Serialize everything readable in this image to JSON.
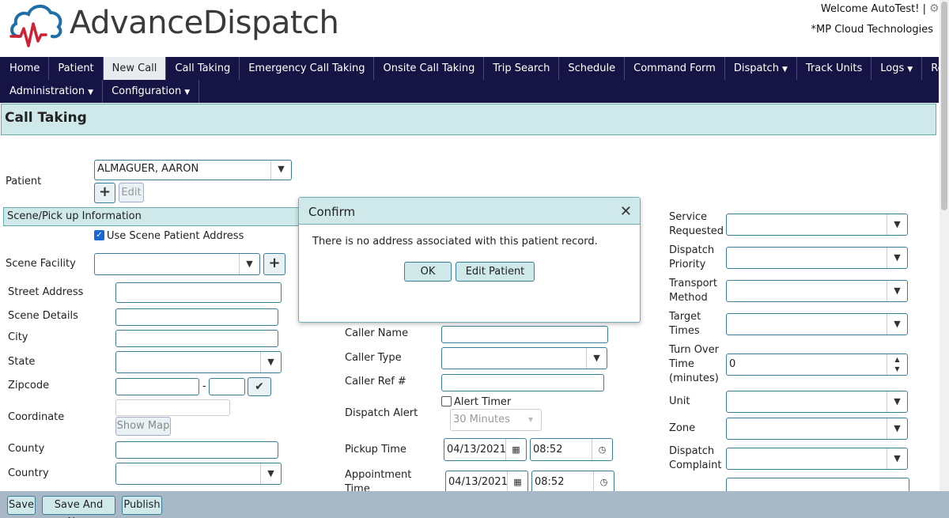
{
  "header": {
    "app_name": "AdvanceDispatch",
    "welcome": "Welcome AutoTest! |",
    "company": "*MP Cloud Technologies"
  },
  "nav": {
    "row1": [
      "Home",
      "Patient",
      "New Call",
      "Call Taking",
      "Emergency Call Taking",
      "Onsite Call Taking",
      "Trip Search",
      "Schedule",
      "Command Form",
      "Dispatch",
      "Track Units",
      "Logs",
      "Reports"
    ],
    "row2": [
      "Administration",
      "Configuration"
    ],
    "active": "New Call"
  },
  "page_title": "Call Taking",
  "form": {
    "patient_label": "Patient",
    "patient_value": "ALMAGUER, AARON",
    "edit_label": "Edit",
    "add_label": "+",
    "section_scene": "Scene/Pick up Information",
    "use_scene_addr": "Use Scene Patient Address",
    "scene_facility": "Scene Facility",
    "street_address": "Street Address",
    "scene_details": "Scene Details",
    "city": "City",
    "state": "State",
    "zipcode": "Zipcode",
    "zip_dash": "-",
    "coordinate": "Coordinate",
    "show_map": "Show Map",
    "county": "County",
    "country": "Country",
    "caller_name": "Caller Name",
    "caller_type": "Caller Type",
    "caller_ref": "Caller Ref #",
    "alert_timer": "Alert Timer",
    "dispatch_alert": "Dispatch Alert",
    "dispatch_alert_value": "30 Minutes",
    "pickup_time": "Pickup Time",
    "pickup_date": "04/13/2021",
    "pickup_clock": "08:52",
    "appointment_time_1": "Appointment",
    "appointment_time_2": "Time",
    "appt_date": "04/13/2021",
    "appt_clock": "08:52",
    "service_requested_1": "Service",
    "service_requested_2": "Requested",
    "dispatch_priority_1": "Dispatch",
    "dispatch_priority_2": "Priority",
    "transport_method_1": "Transport",
    "transport_method_2": "Method",
    "target_times_1": "Target",
    "target_times_2": "Times",
    "turn_over_1": "Turn Over",
    "turn_over_2": "Time",
    "turn_over_3": "(minutes)",
    "turn_over_value": "0",
    "unit": "Unit",
    "zone": "Zone",
    "dispatch_complaint_1": "Dispatch",
    "dispatch_complaint_2": "Complaint"
  },
  "dialog": {
    "title": "Confirm",
    "message": "There is no address associated with this patient record.",
    "ok": "OK",
    "edit_patient": "Edit Patient"
  },
  "footer": {
    "save": "Save",
    "save_and_new": "Save And New",
    "publish": "Publish"
  },
  "colors": {
    "nav_bg": "#161444",
    "accent": "#cfe9ea",
    "border": "#3a7f9a",
    "logo_red": "#cc2233",
    "logo_blue": "#1e6fa8"
  }
}
